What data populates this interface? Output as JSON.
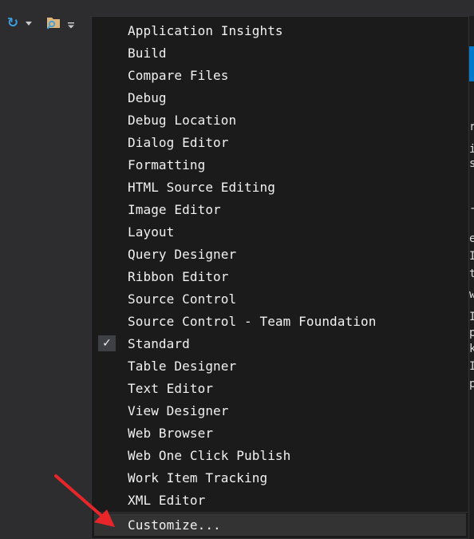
{
  "toolbar": {
    "icons": [
      "refresh-icon",
      "dropdown-arrow-icon",
      "solution-explorer-icon",
      "customize-dropdown-icon"
    ]
  },
  "menu": {
    "items": [
      {
        "label": "Application Insights",
        "checked": false
      },
      {
        "label": "Build",
        "checked": false
      },
      {
        "label": "Compare Files",
        "checked": false
      },
      {
        "label": "Debug",
        "checked": false
      },
      {
        "label": "Debug Location",
        "checked": false
      },
      {
        "label": "Dialog Editor",
        "checked": false
      },
      {
        "label": "Formatting",
        "checked": false
      },
      {
        "label": "HTML Source Editing",
        "checked": false
      },
      {
        "label": "Image Editor",
        "checked": false
      },
      {
        "label": "Layout",
        "checked": false
      },
      {
        "label": "Query Designer",
        "checked": false
      },
      {
        "label": "Ribbon Editor",
        "checked": false
      },
      {
        "label": "Source Control",
        "checked": false
      },
      {
        "label": "Source Control - Team Foundation",
        "checked": false
      },
      {
        "label": "Standard",
        "checked": true
      },
      {
        "label": "Table Designer",
        "checked": false
      },
      {
        "label": "Text Editor",
        "checked": false
      },
      {
        "label": "View Designer",
        "checked": false
      },
      {
        "label": "Web Browser",
        "checked": false
      },
      {
        "label": "Web One Click Publish",
        "checked": false
      },
      {
        "label": "Work Item Tracking",
        "checked": false
      },
      {
        "label": "XML Editor",
        "checked": false
      }
    ],
    "customize_label": "Customize...",
    "check_glyph": "✓"
  },
  "editor_strip": {
    "chars": [
      "r",
      "i",
      "s",
      "-",
      "e",
      "I",
      "t",
      "w",
      "I",
      "p",
      "k",
      "I",
      "p"
    ]
  },
  "colors": {
    "background": "#2d2d30",
    "menu_bg": "#1b1b1c",
    "menu_text": "#f1f1f1",
    "highlight": "#333334",
    "accent": "#007acc",
    "annotation_arrow": "#e8262a"
  }
}
